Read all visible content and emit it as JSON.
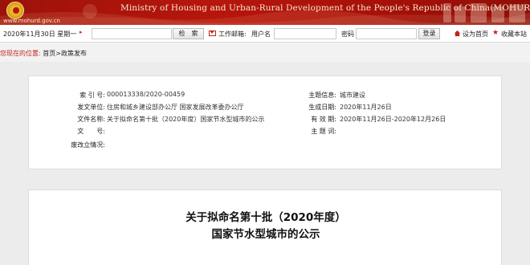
{
  "header": {
    "site_url": "www.mohurd.gov.cn",
    "title": "Ministry of Housing and Urban-Rural Development of the People's Republic of China(MOHURD)"
  },
  "toolbar": {
    "date": "2020年11月30日 星期一",
    "search_button": "检　索",
    "mail_label": "工作邮箱:",
    "username_label": "用户名",
    "password_label": "密码",
    "login_button": "登录",
    "set_home": "设为首页",
    "favorite": "收藏本站"
  },
  "breadcrumb": {
    "location_label": "您现在的位置:",
    "path": "首页>政策发布"
  },
  "info": {
    "index_label": "索 引 号:",
    "index_value": "000013338/2020-00459",
    "issuer_label": "发文单位:",
    "issuer_value": "住房和城乡建设部办公厅  国家发展改革委办公厅",
    "title_label": "文件名称:",
    "title_value": "关于拟命名第十批（2020年度）国家节水型城市的公示",
    "doc_no_label": "文　　号:",
    "doc_no_value": "",
    "status_label": "废改立情况:",
    "status_value": "",
    "topic_label": "主题信息:",
    "topic_value": "城市建设",
    "date_label": "生成日期:",
    "date_value": "2020年11月26日",
    "valid_label": "有 效 期:",
    "valid_value": "2020年11月26日-2020年12月26日",
    "keywords_label": "主 题 词:",
    "keywords_value": ""
  },
  "article": {
    "title_line1": "关于拟命名第十批（2020年度）",
    "title_line2": "国家节水型城市的公示"
  },
  "colors": {
    "banner": "#a81108",
    "accent": "#c0241a"
  }
}
